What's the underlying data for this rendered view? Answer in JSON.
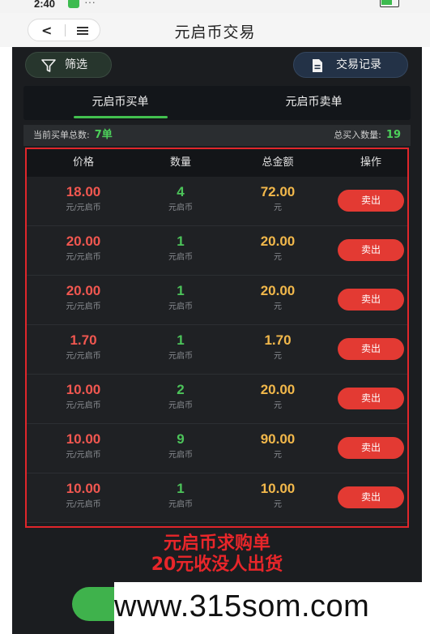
{
  "status_bar": {
    "time": "2:40",
    "dots": "···"
  },
  "title_bar": {
    "title": "元启币交易",
    "back_glyph": "<"
  },
  "toolbar": {
    "filter_label": "筛选",
    "records_label": "交易记录"
  },
  "tabs": [
    {
      "label": "元启币买单",
      "active": true
    },
    {
      "label": "元启币卖单",
      "active": false
    }
  ],
  "summary": {
    "total_orders_label": "当前买单总数:",
    "total_orders_value": "7单",
    "total_qty_label": "总买入数量:",
    "total_qty_value": "19"
  },
  "table": {
    "headers": [
      "价格",
      "数量",
      "总金额",
      "操作"
    ],
    "rows": [
      {
        "price": "18.00",
        "price_unit": "元/元启币",
        "qty": "4",
        "qty_unit": "元启币",
        "total": "72.00",
        "total_unit": "元",
        "action": "卖出"
      },
      {
        "price": "20.00",
        "price_unit": "元/元启币",
        "qty": "1",
        "qty_unit": "元启币",
        "total": "20.00",
        "total_unit": "元",
        "action": "卖出"
      },
      {
        "price": "20.00",
        "price_unit": "元/元启币",
        "qty": "1",
        "qty_unit": "元启币",
        "total": "20.00",
        "total_unit": "元",
        "action": "卖出"
      },
      {
        "price": "1.70",
        "price_unit": "元/元启币",
        "qty": "1",
        "qty_unit": "元启币",
        "total": "1.70",
        "total_unit": "元",
        "action": "卖出"
      },
      {
        "price": "10.00",
        "price_unit": "元/元启币",
        "qty": "2",
        "qty_unit": "元启币",
        "total": "20.00",
        "total_unit": "元",
        "action": "卖出"
      },
      {
        "price": "10.00",
        "price_unit": "元/元启币",
        "qty": "9",
        "qty_unit": "元启币",
        "total": "90.00",
        "total_unit": "元",
        "action": "卖出"
      },
      {
        "price": "10.00",
        "price_unit": "元/元启币",
        "qty": "1",
        "qty_unit": "元启币",
        "total": "10.00",
        "total_unit": "元",
        "action": "卖出"
      }
    ]
  },
  "annotation": {
    "line1": "元启币求购单",
    "line2": "20元收没人出货"
  },
  "bottom_button": {
    "label": ""
  },
  "watermark": {
    "text": "www.315som.com"
  },
  "colors": {
    "background": "#1b1d20",
    "accent_green": "#42c04f",
    "price_red": "#f15750",
    "total_gold": "#f2b84b",
    "sell_button": "#e33a33",
    "highlight_border": "#e0262b"
  }
}
